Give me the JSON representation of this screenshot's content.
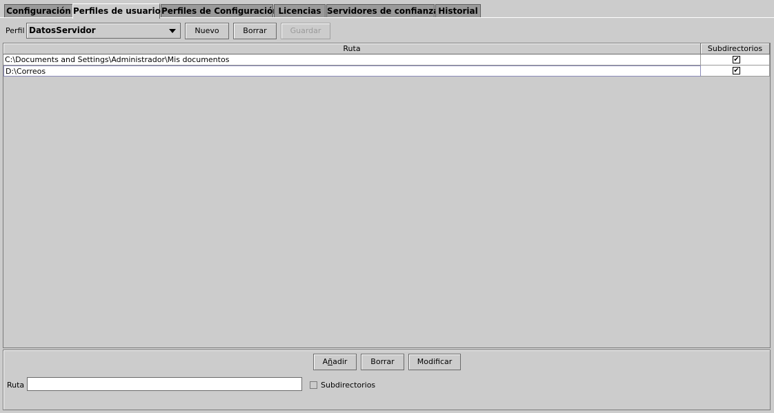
{
  "tabs": [
    {
      "label": "Configuración",
      "active": false
    },
    {
      "label": "Perfiles de usuario",
      "active": true
    },
    {
      "label": "Perfiles de Configuración",
      "active": false
    },
    {
      "label": "Licencias",
      "active": false
    },
    {
      "label": "Servidores de confianza",
      "active": false
    },
    {
      "label": "Historial",
      "active": false
    }
  ],
  "toolbar": {
    "profile_label": "Perfil",
    "profile_value": "DatosServidor",
    "new_label": "Nuevo",
    "delete_label": "Borrar",
    "save_label": "Guardar"
  },
  "table": {
    "columns": [
      "Ruta",
      "Subdirectorios"
    ],
    "rows": [
      {
        "path": "C:\\Documents and Settings\\Administrador\\Mis documentos",
        "subdirs": true
      },
      {
        "path": "D:\\Correos",
        "subdirs": true
      }
    ]
  },
  "editor": {
    "add_label_pre": "A",
    "add_label_mnemonic": "ñ",
    "add_label_post": "adir",
    "delete_label": "Borrar",
    "modify_label": "Modificar",
    "path_label": "Ruta",
    "path_value": "",
    "subdirs_label": "Subdirectorios",
    "subdirs_checked": false
  },
  "icons": {
    "combo_arrow": "triangle-down-icon",
    "check": "checkmark-icon"
  },
  "colors": {
    "background": "#cccccc",
    "tab_inactive": "#9a9a9a",
    "cell_background": "#ffffff"
  }
}
